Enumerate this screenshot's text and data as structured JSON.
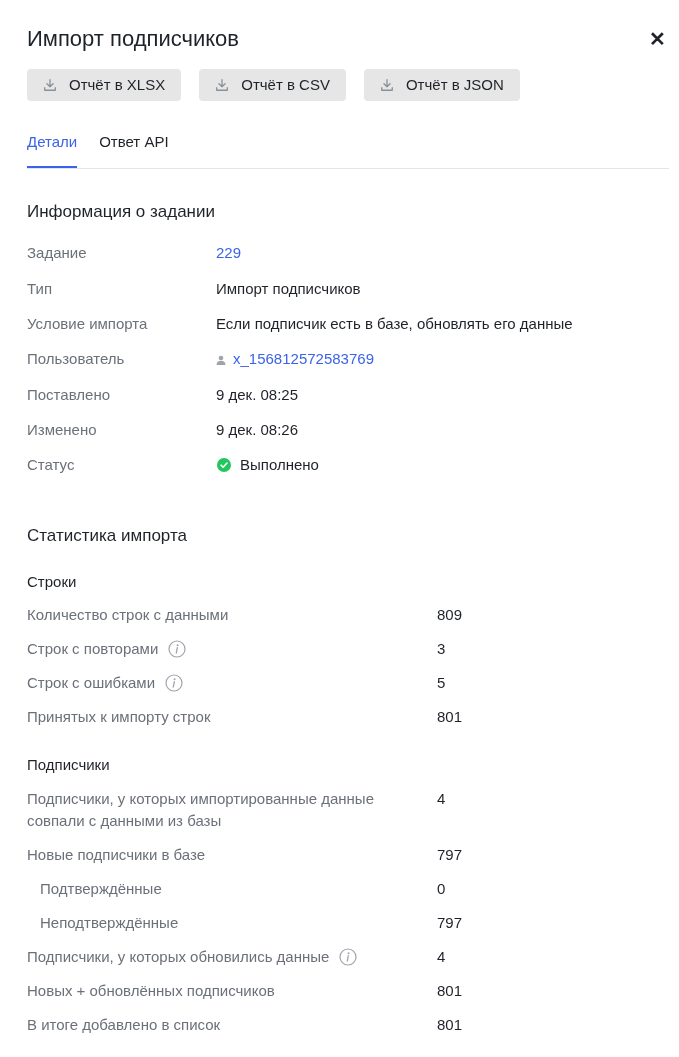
{
  "title": "Импорт подписчиков",
  "close": "✕",
  "buttons": [
    "Отчёт в XLSX",
    "Отчёт в CSV",
    "Отчёт в JSON"
  ],
  "tabs": [
    {
      "label": "Детали",
      "selected": true
    },
    {
      "label": "Ответ API",
      "selected": false
    }
  ],
  "task_info": {
    "heading": "Информация о задании",
    "rows": [
      {
        "label": "Задание",
        "value": "229",
        "kind": "link"
      },
      {
        "label": "Тип",
        "value": "Импорт подписчиков",
        "kind": "text"
      },
      {
        "label": "Условие импорта",
        "value": "Если подписчик есть в базе, обновлять его данные",
        "kind": "text"
      },
      {
        "label": "Пользователь",
        "value": "x_156812572583769",
        "kind": "user"
      },
      {
        "label": "Поставлено",
        "value": "9 дек. 08:25",
        "kind": "text"
      },
      {
        "label": "Изменено",
        "value": "9 дек. 08:26",
        "kind": "text"
      },
      {
        "label": "Статус",
        "value": "Выполнено",
        "kind": "status",
        "color": "#22c55e"
      }
    ]
  },
  "import_stats": {
    "heading": "Статистика импорта",
    "groups": [
      {
        "heading": "Строки",
        "rows": [
          {
            "label": "Количество строк с данными",
            "value": "809",
            "info": false
          },
          {
            "label": "Строк с повторами",
            "value": "3",
            "info": true
          },
          {
            "label": "Строк с ошибками",
            "value": "5",
            "info": true
          },
          {
            "label": "Принятых к импорту строк",
            "value": "801",
            "info": false
          }
        ]
      },
      {
        "heading": "Подписчики",
        "rows": [
          {
            "label": "Подписчики, у которых импортированные данные совпали с данными из базы",
            "value": "4",
            "info": false
          },
          {
            "label": "Новые подписчики в базе",
            "value": "797",
            "info": false,
            "children": [
              {
                "label": "Подтверждённые",
                "value": "0",
                "info": false
              },
              {
                "label": "Неподтверждённые",
                "value": "797",
                "info": false
              }
            ]
          },
          {
            "label": "Подписчики, у которых обновились данные",
            "value": "4",
            "info": true
          },
          {
            "label": "Новых + обновлённых подписчиков",
            "value": "801",
            "info": false
          },
          {
            "label": "В итоге добавлено в список",
            "value": "801",
            "info": false
          }
        ]
      }
    ]
  }
}
